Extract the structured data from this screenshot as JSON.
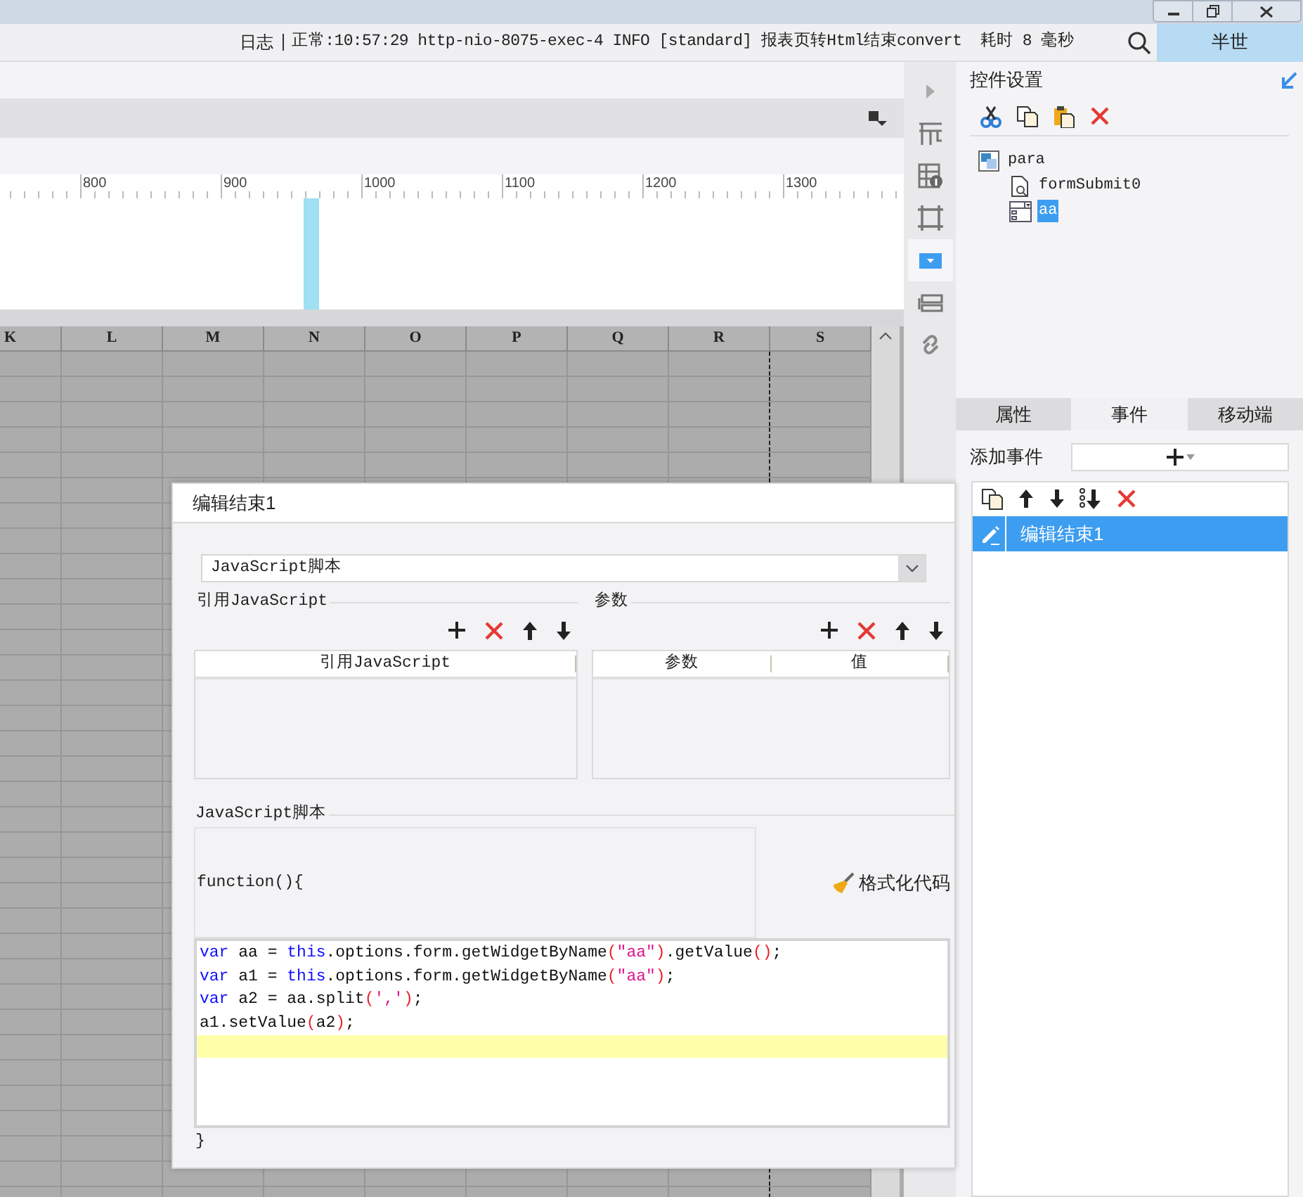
{
  "log_bar": {
    "label": "日志",
    "message": "正常:10:57:29 http-nio-8075-exec-4 INFO [standard] 报表页转Html结束convert  耗时 8 毫秒"
  },
  "user": "半世",
  "ruler": {
    "labels": [
      "800",
      "900",
      "1000",
      "1100",
      "1200",
      "1300"
    ]
  },
  "sheet": {
    "columns": [
      "K",
      "L",
      "M",
      "N",
      "O",
      "P",
      "Q",
      "R",
      "S"
    ]
  },
  "side_tools": [
    {
      "kind": "collapse",
      "selected": false
    },
    {
      "kind": "layout",
      "selected": false
    },
    {
      "kind": "info",
      "selected": false
    },
    {
      "kind": "frame",
      "selected": false
    },
    {
      "kind": "combo",
      "selected": true
    },
    {
      "kind": "label",
      "selected": false
    },
    {
      "kind": "link",
      "selected": false
    }
  ],
  "widget_settings": {
    "title": "控件设置",
    "tree": [
      {
        "label": "para",
        "kind": "form",
        "selected": false,
        "children": [
          {
            "label": "formSubmit0",
            "kind": "submit",
            "selected": false
          },
          {
            "label": "aa",
            "kind": "combo",
            "selected": true
          }
        ]
      }
    ]
  },
  "tabs": [
    {
      "label": "属性",
      "selected": false
    },
    {
      "label": "事件",
      "selected": true
    },
    {
      "label": "移动端",
      "selected": false
    }
  ],
  "add_event": {
    "label": "添加事件"
  },
  "events": [
    {
      "label": "编辑结束1",
      "selected": true
    }
  ],
  "dialog": {
    "title": "编辑结束1",
    "type_select": {
      "value": "JavaScript脚本"
    },
    "reference_section": {
      "title": "引用JavaScript",
      "columns": [
        "引用JavaScript"
      ]
    },
    "params_section": {
      "title": "参数",
      "columns": [
        "参数",
        "值"
      ]
    },
    "script_section": {
      "title": "JavaScript脚本",
      "header": "function(){",
      "footer": "}",
      "format_button": "格式化代码",
      "code": [
        [
          {
            "text": "var",
            "kind": "keyword"
          },
          {
            "text": " aa = ",
            "kind": "plain"
          },
          {
            "text": "this",
            "kind": "keyword"
          },
          {
            "text": ".options.form.getWidgetByName",
            "kind": "plain"
          },
          {
            "text": "(",
            "kind": "paren"
          },
          {
            "text": "\"aa\"",
            "kind": "string"
          },
          {
            "text": ")",
            "kind": "paren"
          },
          {
            "text": ".getValue",
            "kind": "plain"
          },
          {
            "text": "()",
            "kind": "paren"
          },
          {
            "text": ";",
            "kind": "plain"
          }
        ],
        [
          {
            "text": "var",
            "kind": "keyword"
          },
          {
            "text": " a1 = ",
            "kind": "plain"
          },
          {
            "text": "this",
            "kind": "keyword"
          },
          {
            "text": ".options.form.getWidgetByName",
            "kind": "plain"
          },
          {
            "text": "(",
            "kind": "paren"
          },
          {
            "text": "\"aa\"",
            "kind": "string"
          },
          {
            "text": ")",
            "kind": "paren"
          },
          {
            "text": ";",
            "kind": "plain"
          }
        ],
        [
          {
            "text": "var",
            "kind": "keyword"
          },
          {
            "text": " a2 = aa.split",
            "kind": "plain"
          },
          {
            "text": "(",
            "kind": "paren"
          },
          {
            "text": "','",
            "kind": "string"
          },
          {
            "text": ")",
            "kind": "paren"
          },
          {
            "text": ";",
            "kind": "plain"
          }
        ],
        [
          {
            "text": "a1.setValue",
            "kind": "plain"
          },
          {
            "text": "(",
            "kind": "paren"
          },
          {
            "text": "a2",
            "kind": "plain"
          },
          {
            "text": ")",
            "kind": "paren"
          },
          {
            "text": ";",
            "kind": "plain"
          }
        ]
      ]
    }
  }
}
